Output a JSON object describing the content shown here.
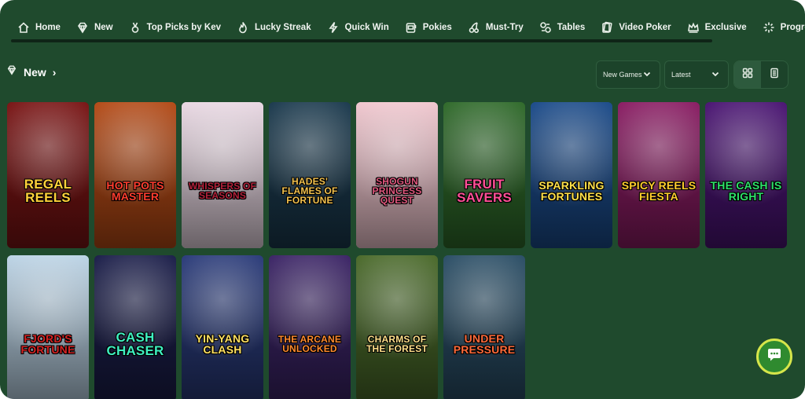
{
  "nav": {
    "items": [
      {
        "label": "Home",
        "icon": "home-icon"
      },
      {
        "label": "New",
        "icon": "diamond-icon"
      },
      {
        "label": "Top Picks by Kev",
        "icon": "medal-icon"
      },
      {
        "label": "Lucky Streak",
        "icon": "flame-icon"
      },
      {
        "label": "Quick Win",
        "icon": "lightning-icon"
      },
      {
        "label": "Pokies",
        "icon": "slot-machine-icon"
      },
      {
        "label": "Must-Try",
        "icon": "cherry-icon"
      },
      {
        "label": "Tables",
        "icon": "chips-icon"
      },
      {
        "label": "Video Poker",
        "icon": "cards-icon"
      },
      {
        "label": "Exclusive",
        "icon": "crown-icon"
      },
      {
        "label": "Progressives",
        "icon": "sparkle-icon"
      }
    ]
  },
  "section": {
    "title": "New",
    "filter_label": "New Games",
    "sort_label": "Latest"
  },
  "games": [
    {
      "title": "REGAL REELS",
      "bg": "#7a1414",
      "accent": "#ffd23a"
    },
    {
      "title": "HOT POTS MASTER",
      "bg": "#b44a16",
      "accent": "#ff3d2e"
    },
    {
      "title": "WHISPERS OF SEASONS",
      "bg": "#e9d8e3",
      "accent": "#b2213a"
    },
    {
      "title": "HADES' FLAMES OF FORTUNE",
      "bg": "#1b3a4e",
      "accent": "#f2c14e"
    },
    {
      "title": "SHOGUN PRINCESS QUEST",
      "bg": "#f1c7cf",
      "accent": "#e2577e"
    },
    {
      "title": "FRUIT SAVERS",
      "bg": "#2f6a2a",
      "accent": "#ff4f96"
    },
    {
      "title": "SPARKLING FORTUNES",
      "bg": "#1b4b8a",
      "accent": "#ffe14a"
    },
    {
      "title": "SPICY REELS FIESTA",
      "bg": "#8a1c63",
      "accent": "#ffcc2e"
    },
    {
      "title": "THE CASH IS RIGHT",
      "bg": "#4a1473",
      "accent": "#2ee06a"
    },
    {
      "title": "FJORD'S FORTUNE",
      "bg": "#bcd4e6",
      "accent": "#d42222"
    },
    {
      "title": "CASH CHASER",
      "bg": "#1b1e4a",
      "accent": "#3ff0c0"
    },
    {
      "title": "YIN-YANG CLASH",
      "bg": "#2a3b7a",
      "accent": "#ffe060"
    },
    {
      "title": "THE ARCANE UNLOCKED",
      "bg": "#3b2466",
      "accent": "#ff8a2e"
    },
    {
      "title": "CHARMS OF THE FOREST",
      "bg": "#4a6a2a",
      "accent": "#ffe08a"
    },
    {
      "title": "UNDER PRESSURE",
      "bg": "#2a4e66",
      "accent": "#ff6a3a"
    }
  ],
  "colors": {
    "background": "#1f4a2d",
    "chat_button": "#2f8a2f",
    "chat_ring": "#d6e64a"
  }
}
